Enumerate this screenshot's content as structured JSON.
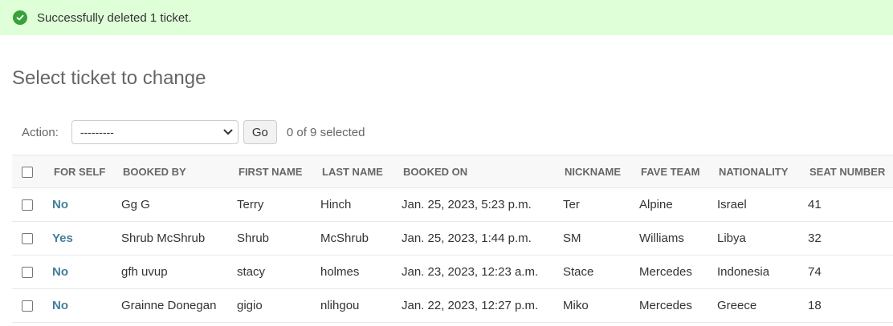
{
  "message": {
    "text": "Successfully deleted 1 ticket.",
    "icon": "check-circle-icon",
    "color": "#38a13a",
    "background": "#dfffd8"
  },
  "page_title": "Select ticket to change",
  "actions": {
    "label": "Action:",
    "select_value": "---------",
    "go_label": "Go",
    "selected_count": "0 of 9 selected"
  },
  "table": {
    "columns": [
      "FOR SELF",
      "BOOKED BY",
      "FIRST NAME",
      "LAST NAME",
      "BOOKED ON",
      "NICKNAME",
      "FAVE TEAM",
      "NATIONALITY",
      "SEAT NUMBER"
    ],
    "rows": [
      [
        "No",
        "Gg G",
        "Terry",
        "Hinch",
        "Jan. 25, 2023, 5:23 p.m.",
        "Ter",
        "Alpine",
        "Israel",
        "41"
      ],
      [
        "Yes",
        "Shrub McShrub",
        "Shrub",
        "McShrub",
        "Jan. 25, 2023, 1:44 p.m.",
        "SM",
        "Williams",
        "Libya",
        "32"
      ],
      [
        "No",
        "gfh uvup",
        "stacy",
        "holmes",
        "Jan. 23, 2023, 12:23 a.m.",
        "Stace",
        "Mercedes",
        "Indonesia",
        "74"
      ],
      [
        "No",
        "Grainne Donegan",
        "gigio",
        "nlihgou",
        "Jan. 22, 2023, 12:27 p.m.",
        "Miko",
        "Mercedes",
        "Greece",
        "18"
      ]
    ]
  },
  "colors": {
    "link": "#447e9b",
    "header_bg": "#f8f8f8"
  }
}
